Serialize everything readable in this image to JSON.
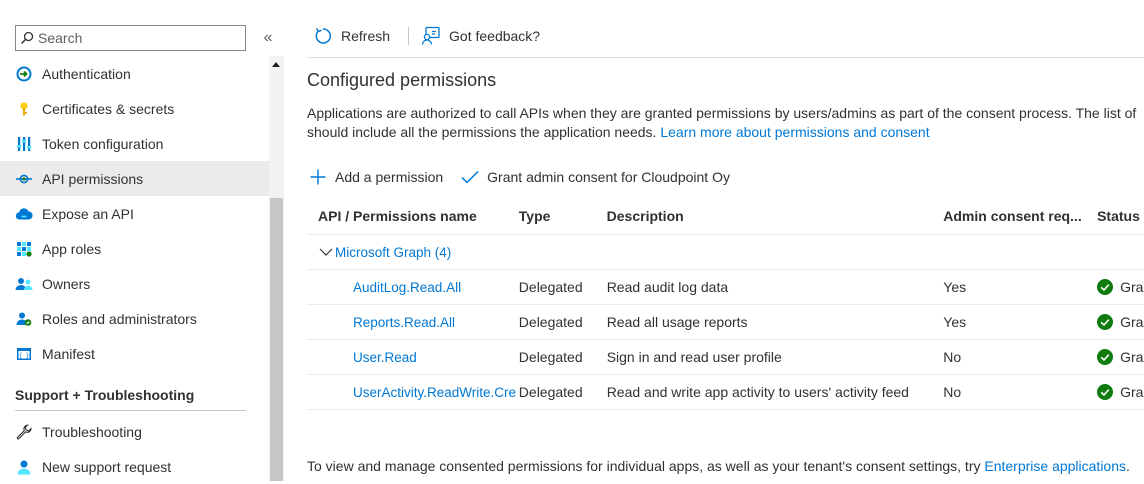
{
  "sidebar": {
    "search": {
      "placeholder": "Search",
      "value": ""
    },
    "collapse_glyph": "«",
    "items": [
      {
        "label": "Authentication",
        "icon": "authentication-icon"
      },
      {
        "label": "Certificates & secrets",
        "icon": "key-icon"
      },
      {
        "label": "Token configuration",
        "icon": "token-config-icon"
      },
      {
        "label": "API permissions",
        "icon": "api-permissions-icon",
        "active": true
      },
      {
        "label": "Expose an API",
        "icon": "cloud-icon"
      },
      {
        "label": "App roles",
        "icon": "app-roles-icon"
      },
      {
        "label": "Owners",
        "icon": "owners-icon"
      },
      {
        "label": "Roles and administrators",
        "icon": "roles-admin-icon"
      },
      {
        "label": "Manifest",
        "icon": "manifest-icon"
      }
    ],
    "support_section": {
      "title": "Support + Troubleshooting",
      "items": [
        {
          "label": "Troubleshooting",
          "icon": "wrench-icon"
        },
        {
          "label": "New support request",
          "icon": "support-person-icon"
        }
      ]
    }
  },
  "toolbar": {
    "refresh_label": "Refresh",
    "feedback_label": "Got feedback?"
  },
  "main": {
    "title": "Configured permissions",
    "description_line1": "Applications are authorized to call APIs when they are granted permissions by users/admins as part of the consent process. The list of",
    "description_line2": "should include all the permissions the application needs.",
    "learn_more_link": "Learn more about permissions and consent",
    "add_permission_label": "Add a permission",
    "grant_consent_label": "Grant admin consent for Cloudpoint Oy",
    "table": {
      "headers": {
        "name": "API / Permissions name",
        "type": "Type",
        "description": "Description",
        "admin": "Admin consent req...",
        "status": "Status"
      },
      "group_label": "Microsoft Graph (4)",
      "rows": [
        {
          "name": "AuditLog.Read.All",
          "type": "Delegated",
          "description": "Read audit log data",
          "admin": "Yes",
          "status": "Gra"
        },
        {
          "name": "Reports.Read.All",
          "type": "Delegated",
          "description": "Read all usage reports",
          "admin": "Yes",
          "status": "Gra"
        },
        {
          "name": "User.Read",
          "type": "Delegated",
          "description": "Sign in and read user profile",
          "admin": "No",
          "status": "Gra"
        },
        {
          "name": "UserActivity.ReadWrite.Cre",
          "type": "Delegated",
          "description": "Read and write app activity to users' activity feed",
          "admin": "No",
          "status": "Gra"
        }
      ]
    },
    "footer_text": "To view and manage consented permissions for individual apps, as well as your tenant's consent settings, try",
    "footer_link": "Enterprise applications",
    "footer_end": "."
  },
  "colors": {
    "accent": "#0078d4",
    "granted": "#107c10",
    "active_bg": "#edebe9"
  }
}
